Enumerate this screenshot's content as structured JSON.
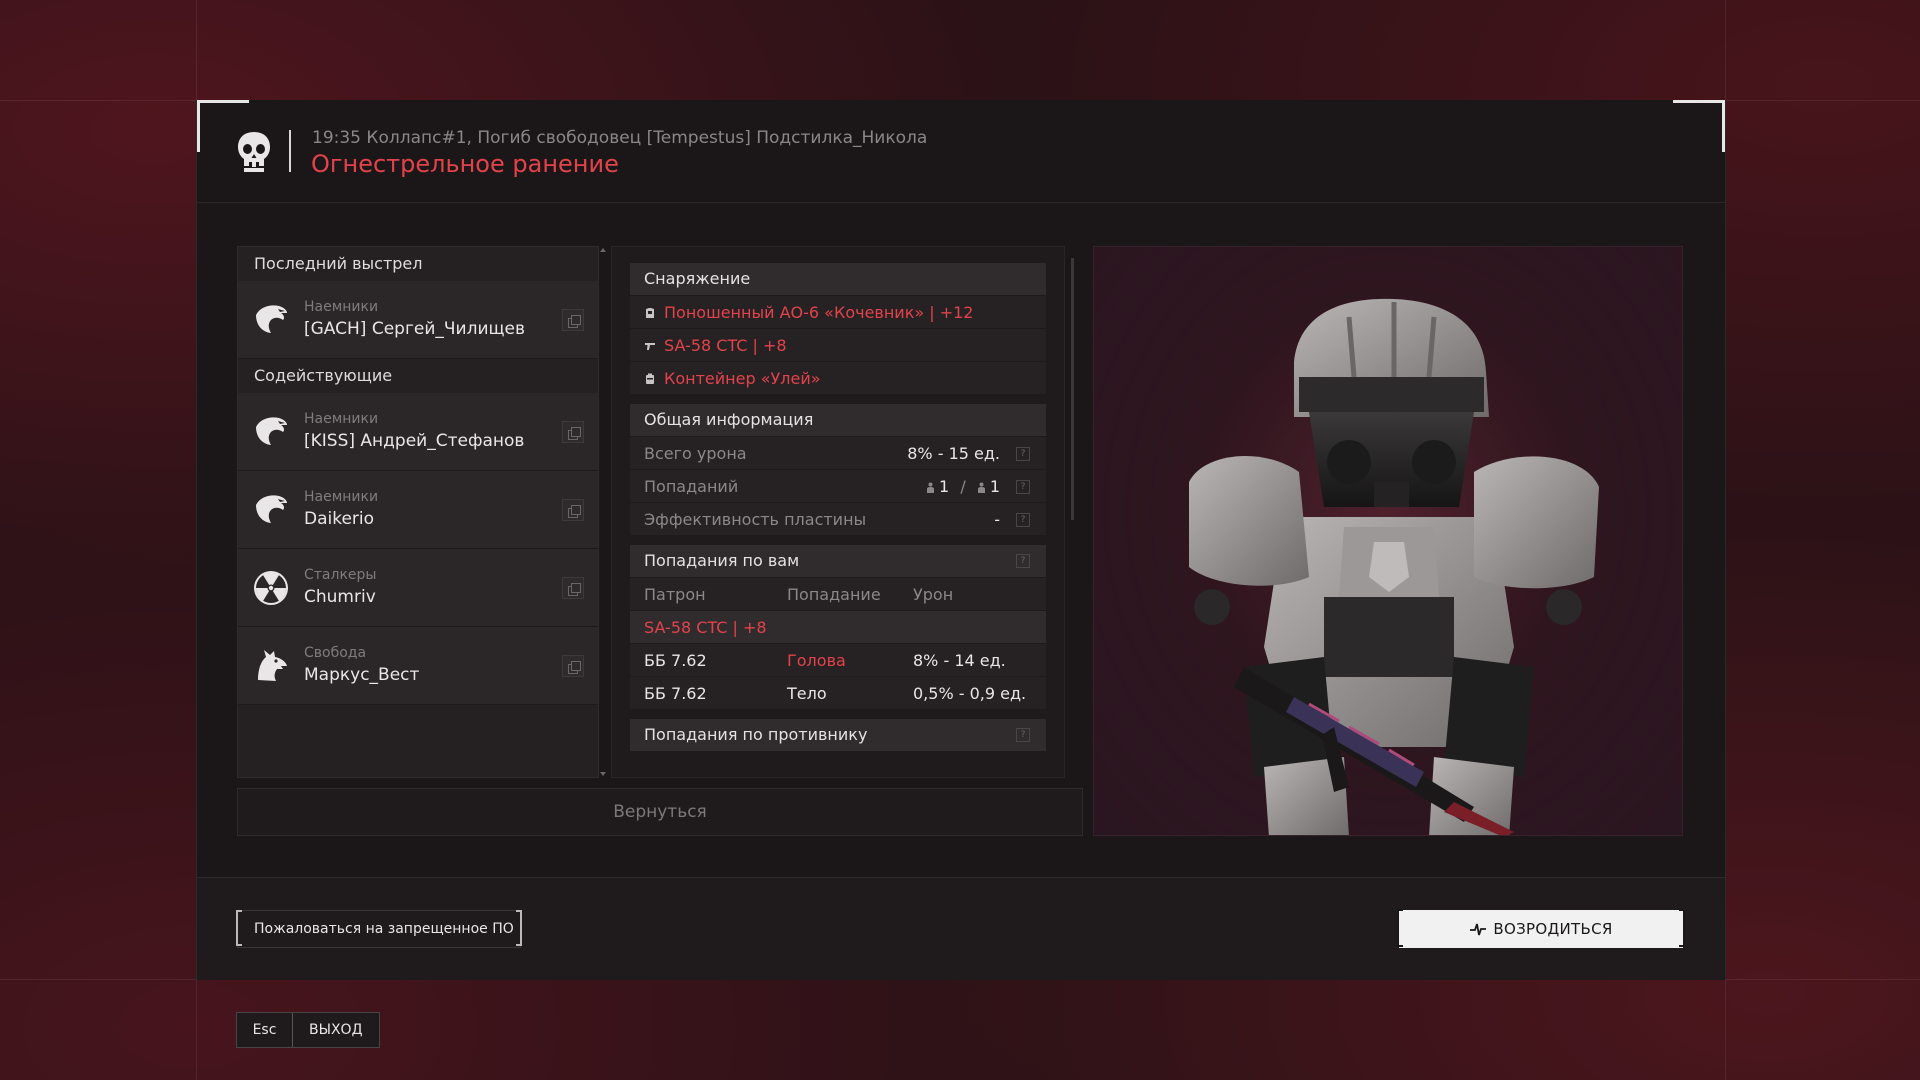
{
  "header": {
    "subtitle": "19:35 Коллапс#1, Погиб свободовец [Tempestus] Подстилка_Никола",
    "title": "Огнестрельное ранение"
  },
  "last_shot": {
    "label": "Последний выстрел",
    "player": {
      "faction": "Наемники",
      "name": "[GACH] Сергей_Чилищев",
      "emblem": "eagle-icon"
    }
  },
  "assistants": {
    "label": "Содействующие",
    "players": [
      {
        "faction": "Наемники",
        "name": "[KISS] Андрей_Стефанов",
        "emblem": "eagle-icon"
      },
      {
        "faction": "Наемники",
        "name": "Daikerio",
        "emblem": "eagle-icon"
      },
      {
        "faction": "Сталкеры",
        "name": "Chumriv",
        "emblem": "radiation-icon"
      },
      {
        "faction": "Свобода",
        "name": "Маркус_Вест",
        "emblem": "wolf-icon"
      }
    ]
  },
  "equipment": {
    "label": "Снаряжение",
    "items": [
      {
        "icon": "armor-icon",
        "text": "Поношенный АО-6 «Кочевник» | +12"
      },
      {
        "icon": "rifle-icon",
        "text": "SA-58 CTC | +8"
      },
      {
        "icon": "container-icon",
        "text": "Контейнер «Улей»"
      }
    ]
  },
  "general_info": {
    "label": "Общая информация",
    "total_damage_label": "Всего урона",
    "total_damage_value": "8% - 15 ед.",
    "hits_label": "Попаданий",
    "hits_a": "1",
    "hits_sep": "/",
    "hits_b": "1",
    "plate_label": "Эффективность пластины",
    "plate_value": "-",
    "info_glyph": "?"
  },
  "hits_on_you": {
    "label": "Попадания по вам",
    "columns": [
      "Патрон",
      "Попадание",
      "Урон"
    ],
    "weapon": "SA-58 CTC | +8",
    "rows": [
      {
        "ammo": "ББ 7.62",
        "zone": "Голова",
        "damage": "8% - 14 ед."
      },
      {
        "ammo": "ББ 7.62",
        "zone": "Тело",
        "damage": "0,5% - 0,9 ед."
      }
    ]
  },
  "hits_on_enemy": {
    "label": "Попадания по противнику"
  },
  "buttons": {
    "back": "Вернуться",
    "report": "Пожаловаться на запрещенное ПО",
    "respawn": "ВОЗРОДИТЬСЯ",
    "esc_key": "Esc",
    "exit": "ВЫХОД"
  },
  "colors": {
    "accent_red": "#e2434b",
    "panel": "#252123",
    "background": "#2a1216"
  }
}
